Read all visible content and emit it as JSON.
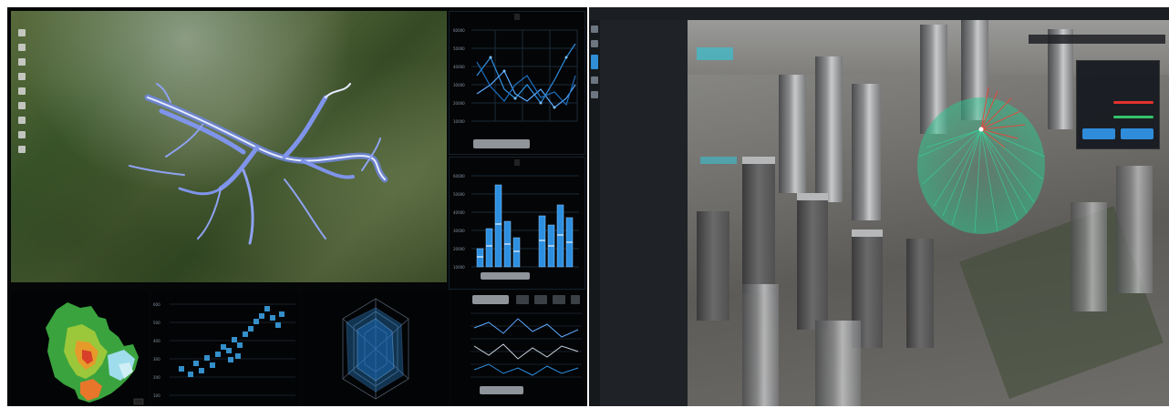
{
  "left_dashboard": {
    "map": {
      "toolbar_icons": [
        "zoom-in-icon",
        "zoom-out-icon",
        "rotate-icon",
        "layers-icon",
        "pan-icon",
        "measure-icon",
        "draw-icon",
        "camera-icon",
        "home-icon"
      ],
      "caption": "",
      "river_color": "#7f94ea"
    },
    "line_panel": {
      "title": "",
      "buttons": [
        "",
        "",
        ""
      ]
    },
    "bar_panel": {
      "title": "",
      "bar_color": "#2d8fe0"
    },
    "table_panel": {
      "buttons": [
        "",
        ""
      ]
    },
    "accent": "#2d8fe0"
  },
  "right_app": {
    "title": "",
    "window_controls": "",
    "sidebar_icons": [
      "home-icon",
      "layers-icon",
      "analysis-icon",
      "tools-icon",
      "settings-icon"
    ],
    "tree": [
      "",
      "",
      "",
      "",
      "",
      "",
      "",
      ""
    ],
    "toolbar": [
      "",
      "",
      "",
      "",
      ""
    ],
    "float_panel": {
      "title": "",
      "rows": [
        "",
        "",
        ""
      ],
      "line_colors": [
        "#e5322d",
        "#35c46a"
      ],
      "buttons": [
        "",
        ""
      ]
    },
    "viewshed_colors": {
      "visible": "#2fc48f",
      "hidden": "#e8473a"
    }
  }
}
